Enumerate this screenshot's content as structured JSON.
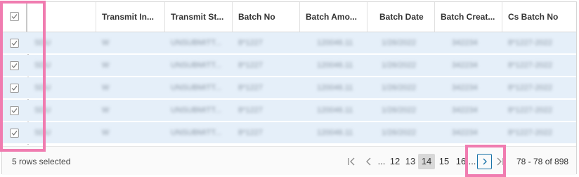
{
  "grid": {
    "columns": [
      {
        "label": ""
      },
      {
        "label": "Transmit In..."
      },
      {
        "label": "Transmit St..."
      },
      {
        "label": "Batch No"
      },
      {
        "label": "Batch Amo..."
      },
      {
        "label": "Batch Date"
      },
      {
        "label": "Batch Creat..."
      },
      {
        "label": "Cs Batch No"
      }
    ],
    "rows": [
      {
        "c0": "SDU",
        "c1": "W",
        "c2": "UNSUBMITT...",
        "c3": "8*1227",
        "c4": "120046.11",
        "c5": "1/26/2022",
        "c6": "342234",
        "c7": "8*1227-2022"
      },
      {
        "c0": "SDU",
        "c1": "W",
        "c2": "UNSUBMITT...",
        "c3": "8*1227",
        "c4": "120046.11",
        "c5": "1/26/2022",
        "c6": "342234",
        "c7": "8*1227-2022"
      },
      {
        "c0": "SDU",
        "c1": "W",
        "c2": "UNSUBMITT...",
        "c3": "8*1227",
        "c4": "120046.11",
        "c5": "1/26/2022",
        "c6": "342234",
        "c7": "8*1227-2022"
      },
      {
        "c0": "SDU",
        "c1": "W",
        "c2": "UNSUBMITT...",
        "c3": "8*1227",
        "c4": "120046.11",
        "c5": "1/26/2022",
        "c6": "342234",
        "c7": "8*1227-2022"
      },
      {
        "c0": "SDU",
        "c1": "W",
        "c2": "UNSUBMITT...",
        "c3": "8*1227",
        "c4": "120046.11",
        "c5": "1/26/2022",
        "c6": "342234",
        "c7": "8*1227-2022"
      }
    ]
  },
  "footer": {
    "status": "5 rows selected",
    "pager": {
      "first_icon": "first-page-icon",
      "prev_icon": "prev-page-icon",
      "ellipsis_left": "...",
      "pages": [
        "12",
        "13",
        "14",
        "15",
        "16"
      ],
      "active_page": "14",
      "ellipsis_right": "...",
      "next_icon": "next-page-icon",
      "last_icon": "last-page-icon"
    },
    "range": "78 - 78 of 898"
  },
  "colors": {
    "row_selected": "#e5eff9",
    "highlight": "#f07cb0",
    "next_button": "#1a73a8"
  }
}
